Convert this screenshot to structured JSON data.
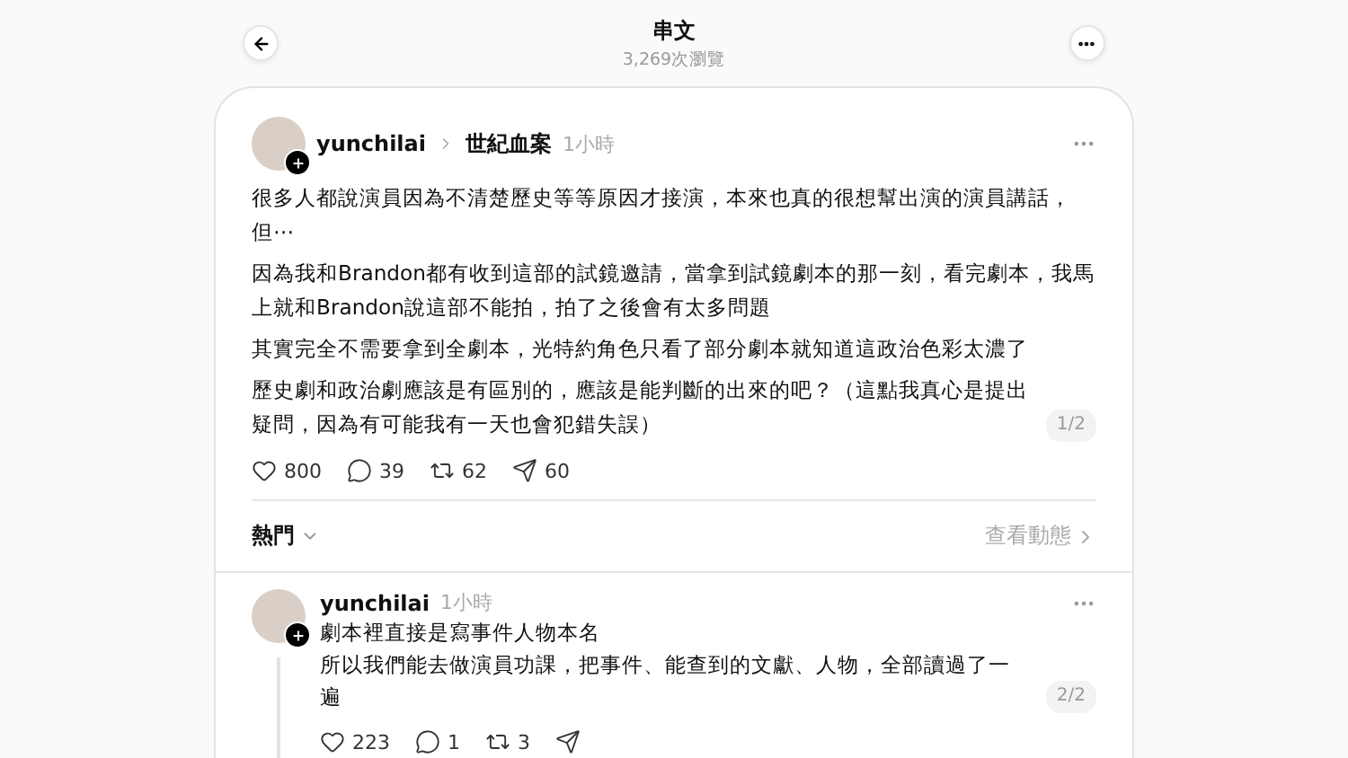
{
  "header": {
    "title": "串文",
    "views": "3,269次瀏覽"
  },
  "post": {
    "author": "yunchilai",
    "topic": "世紀血案",
    "time": "1小時",
    "paragraphs": [
      "很多人都說演員因為不清楚歷史等等原因才接演，本來也真的很想幫出演的演員講話，但⋯",
      "因為我和Brandon都有收到這部的試鏡邀請，當拿到試鏡劇本的那一刻，看完劇本，我馬上就和Brandon說這部不能拍，拍了之後會有太多問題",
      "其實完全不需要拿到全劇本，光特約角色只看了部分劇本就知道這政治色彩太濃了",
      "歷史劇和政治劇應該是有區別的，應該是能判斷的出來的吧？（這點我真心是提出疑問，因為有可能我有一天也會犯錯失誤）"
    ],
    "page": "1/2",
    "stats": [
      {
        "kind": "like",
        "count": "800"
      },
      {
        "kind": "comment",
        "count": "39"
      },
      {
        "kind": "repost",
        "count": "62"
      },
      {
        "kind": "share",
        "count": "60"
      }
    ]
  },
  "sort": {
    "label": "熱門",
    "link": "查看動態"
  },
  "reply": {
    "author": "yunchilai",
    "time": "1小時",
    "lines": [
      "劇本裡直接是寫事件人物本名",
      "所以我們能去做演員功課，把事件、能查到的文獻、人物，全部讀過了一遍"
    ],
    "page": "2/2",
    "stats": [
      {
        "kind": "like",
        "count": "223"
      },
      {
        "kind": "comment",
        "count": "1"
      },
      {
        "kind": "repost",
        "count": "3"
      },
      {
        "kind": "share"
      }
    ]
  }
}
